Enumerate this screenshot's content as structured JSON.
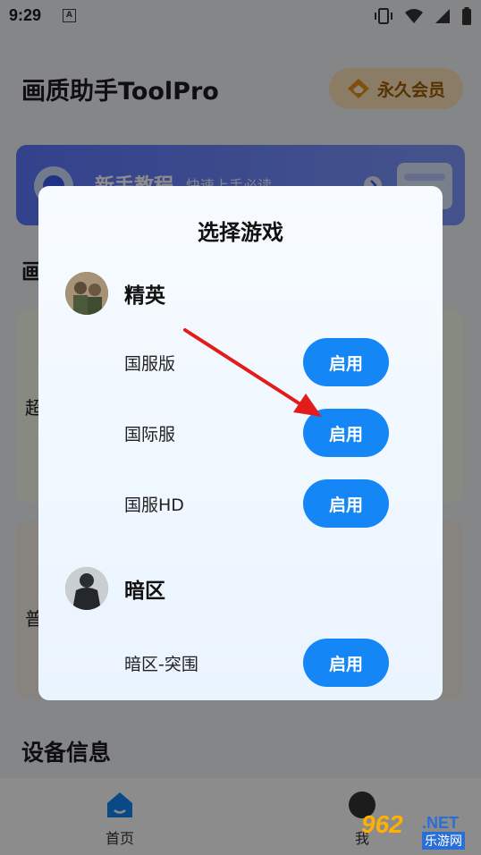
{
  "status_bar": {
    "time": "9:29",
    "notif_letter": "A"
  },
  "app": {
    "title": "画质助手ToolPro",
    "vip_label": "永久会员",
    "tutorial": {
      "title": "新手教程",
      "subtitle": "快速上手必读"
    },
    "section_1_initial": "画",
    "card_1_initial": "超",
    "card_2_initial": "普",
    "device_section_title": "设备信息"
  },
  "bottom_nav": {
    "home_label": "首页",
    "mine_label": "我"
  },
  "dialog": {
    "title": "选择游戏",
    "games": [
      {
        "name": "精英",
        "servers": [
          {
            "label": "国服版",
            "button": "启用"
          },
          {
            "label": "国际服",
            "button": "启用"
          },
          {
            "label": "国服HD",
            "button": "启用"
          }
        ]
      },
      {
        "name": "暗区",
        "servers": [
          {
            "label": "暗区-突围",
            "button": "启用"
          }
        ]
      }
    ]
  },
  "watermark": {
    "number": "962",
    "net": ".NET",
    "site": "乐游网"
  },
  "colors": {
    "accent": "#1486f5",
    "arrow": "#e21b1b",
    "vip": "#9b5b00"
  }
}
